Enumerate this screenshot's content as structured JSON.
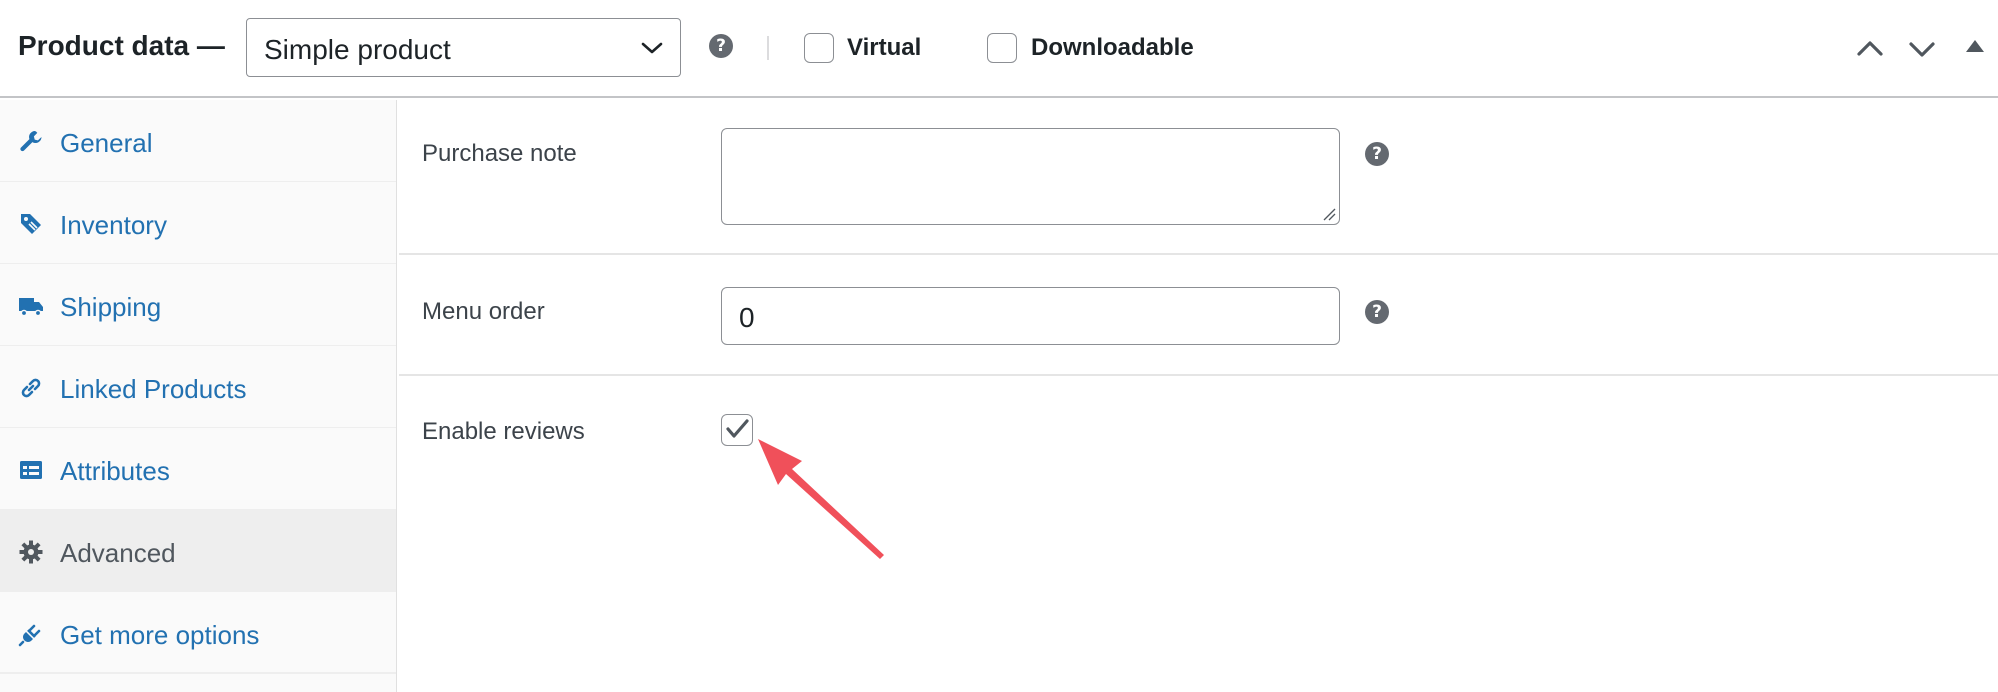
{
  "header": {
    "title": "Product data —",
    "product_type": {
      "selected": "Simple product",
      "icon": "chevron-down-icon"
    },
    "help_icon": "?",
    "checkboxes": [
      {
        "label": "Virtual",
        "checked": false
      },
      {
        "label": "Downloadable",
        "checked": false
      }
    ],
    "controls": [
      "chevron-up-icon",
      "chevron-down-icon",
      "triangle-toggle-icon"
    ]
  },
  "sidebar": {
    "items": [
      {
        "label": "General",
        "icon": "wrench-icon",
        "active": false
      },
      {
        "label": "Inventory",
        "icon": "tag-icon",
        "active": false
      },
      {
        "label": "Shipping",
        "icon": "truck-icon",
        "active": false
      },
      {
        "label": "Linked Products",
        "icon": "link-icon",
        "active": false
      },
      {
        "label": "Attributes",
        "icon": "list-card-icon",
        "active": false
      },
      {
        "label": "Advanced",
        "icon": "gear-icon",
        "active": true
      },
      {
        "label": "Get more options",
        "icon": "plugin-icon",
        "active": false
      }
    ]
  },
  "fields": {
    "purchase_note": {
      "label": "Purchase note",
      "value": "",
      "help": "?"
    },
    "menu_order": {
      "label": "Menu order",
      "value": "0",
      "help": "?"
    },
    "enable_reviews": {
      "label": "Enable reviews",
      "checked": true
    }
  },
  "annotation": {
    "type": "arrow",
    "color": "#f0505a"
  },
  "colors": {
    "link": "#2271b1",
    "active_tab_bg": "#eeeeee",
    "help_icon_bg": "#646970",
    "border": "#8c8f94"
  }
}
